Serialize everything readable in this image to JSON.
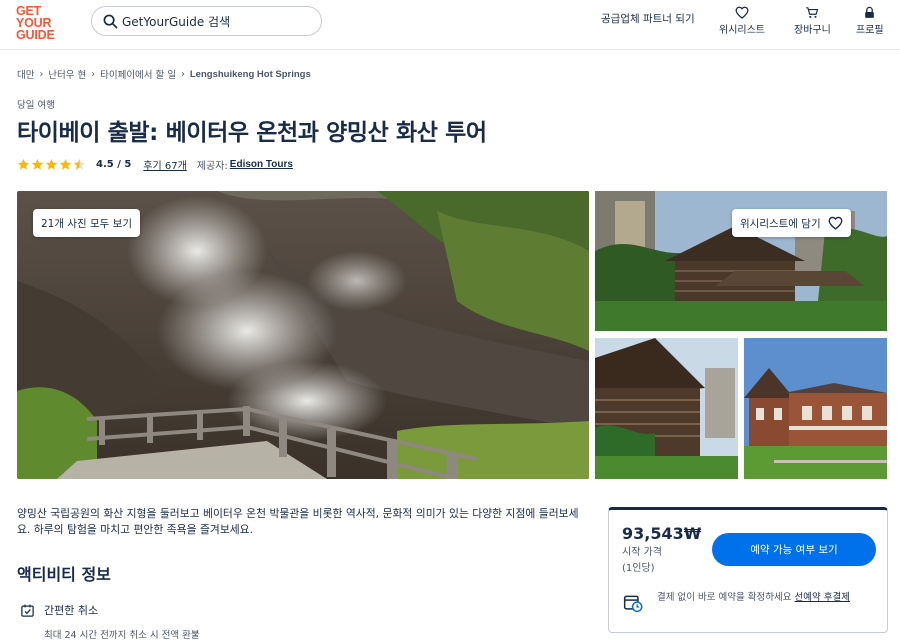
{
  "header": {
    "logo": [
      "GET",
      "YOUR",
      "GUIDE"
    ],
    "search_placeholder": "GetYourGuide 검색",
    "partner_link": "공급업체 파트너 되기",
    "nav": [
      {
        "label": "위시리스트",
        "icon": "heart-icon"
      },
      {
        "label": "장바구니",
        "icon": "cart-icon"
      },
      {
        "label": "프로필",
        "icon": "lock-icon"
      }
    ]
  },
  "breadcrumb": [
    "대만",
    "난터우 현",
    "타이페이에서 할 일",
    "Lengshuikeng Hot Springs"
  ],
  "category": "당일 여행",
  "title": "타이베이 출발: 베이터우 온천과 양밍산 화산 투어",
  "rating": {
    "score": 4.5,
    "score_text": "4.5 / 5",
    "reviews_text": "후기 67개",
    "provider_label": "제공자:",
    "provider_name": "Edison Tours"
  },
  "gallery": {
    "view_all_label": "21개 사진 모두 보기",
    "wishlist_label": "위시리스트에 담기"
  },
  "description": "양밍산 국립공원의 화산 지형을 둘러보고 베이터우 온천 박물관을 비롯한 역사적, 문화적 의미가 있는 다양한 지점에 들러보세요. 하루의 탐험을 마치고 편안한 족욕을 즐겨보세요.",
  "activity": {
    "section_title": "액티비티 정보",
    "features": [
      {
        "label": "간편한 취소",
        "detail": "최대 24 시간 전까지 취소 시 전액 환불",
        "icon": "calendar-check-icon"
      }
    ]
  },
  "booking": {
    "price": "93,543₩",
    "price_label_1": "시작 가격",
    "price_label_2": "(1인당)",
    "button_label": "예약 가능 여부 보기",
    "reserve_text": "결제 없이 바로 예약을 확정하세요",
    "reserve_link": "선예약 후결제"
  },
  "colors": {
    "brand": "#ff5533",
    "primary_button": "#0071eb",
    "text": "#1a2b49",
    "star": "#ffb800"
  }
}
